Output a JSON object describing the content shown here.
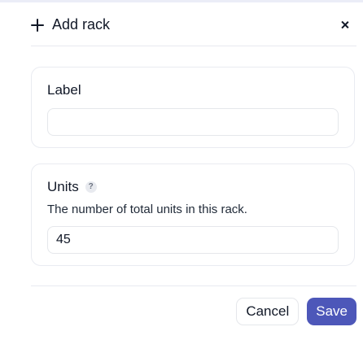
{
  "dialog": {
    "title": "Add rack",
    "header_icon": "plus-icon",
    "close_icon": "close-icon"
  },
  "fields": {
    "label": {
      "label": "Label",
      "value": ""
    },
    "units": {
      "label": "Units",
      "help_icon": "question-icon",
      "help_text": "?",
      "description": "The number of total units in this rack.",
      "value": "45"
    }
  },
  "footer": {
    "cancel_label": "Cancel",
    "save_label": "Save"
  },
  "colors": {
    "accent": "#4d57b9",
    "border": "#e5e7eb",
    "text": "#111827"
  }
}
